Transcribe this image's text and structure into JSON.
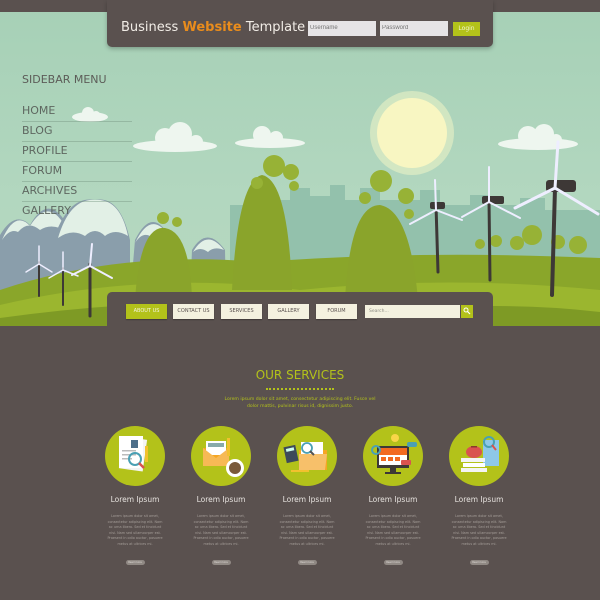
{
  "header": {
    "brand_prefix": "Business",
    "brand_accent": "Website",
    "brand_suffix": "Template",
    "username_placeholder": "Username",
    "password_placeholder": "Password",
    "login_label": "Login"
  },
  "sidebar": {
    "title": "SIDEBAR MENU",
    "items": [
      {
        "label": "HOME"
      },
      {
        "label": "BLOG"
      },
      {
        "label": "PROFILE"
      },
      {
        "label": "FORUM"
      },
      {
        "label": "ARCHIVES"
      },
      {
        "label": "GALLERY"
      }
    ]
  },
  "nav": {
    "items": [
      {
        "label": "ABOUT US",
        "active": true
      },
      {
        "label": "CONTACT US",
        "active": false
      },
      {
        "label": "SERVICES",
        "active": false
      },
      {
        "label": "GALLERY",
        "active": false
      },
      {
        "label": "FORUM",
        "active": false
      }
    ],
    "search_placeholder": "Search...",
    "search_icon": "magnifier-icon"
  },
  "services": {
    "title": "OUR SERVICES",
    "description": "Lorem ipsum dolor sit amet, consectetur adipiscing elit. Fusce vel dolor mattis, pulvinar risus id, dignissim justo.",
    "cards": [
      {
        "icon": "documents-magnifier-icon",
        "title": "Lorem Ipsum",
        "text": "Lorem ipsum dolor sit amet, consectetur adipiscing elit. Nam ac urna libero. Sed et tincidunt nisi. Nam sed ullamcorper est. Praesent in odio auctor, posuere metus at ultrices mi.",
        "button": "Read more"
      },
      {
        "icon": "envelope-coffee-icon",
        "title": "Lorem Ipsum",
        "text": "Lorem ipsum dolor sit amet, consectetur adipiscing elit. Nam ac urna libero. Sed et tincidunt nisi. Nam sed ullamcorper est. Praesent in odio auctor, posuere metus at ultrices mi.",
        "button": "Read more"
      },
      {
        "icon": "calculator-folder-icon",
        "title": "Lorem Ipsum",
        "text": "Lorem ipsum dolor sit amet, consectetur adipiscing elit. Nam ac urna libero. Sed et tincidunt nisi. Nam sed ullamcorper est. Praesent in odio auctor, posuere metus at ultrices mi.",
        "button": "Read more"
      },
      {
        "icon": "monitor-website-icon",
        "title": "Lorem Ipsum",
        "text": "Lorem ipsum dolor sit amet, consectetur adipiscing elit. Nam ac urna libero. Sed et tincidunt nisi. Nam sed ullamcorper est. Praesent in odio auctor, posuere metus at ultrices mi.",
        "button": "Read more"
      },
      {
        "icon": "books-piggybank-icon",
        "title": "Lorem Ipsum",
        "text": "Lorem ipsum dolor sit amet, consectetur adipiscing elit. Nam ac urna libero. Sed et tincidunt nisi. Nam sed ullamcorper est. Praesent in odio auctor, posuere metus at ultrices mi.",
        "button": "Read more"
      }
    ]
  },
  "colors": {
    "dark": "#5a514f",
    "accent_green": "#b3c21a",
    "accent_orange": "#e98c1c",
    "sky": "#a6d0b6",
    "button_cream": "#f4f1df"
  }
}
